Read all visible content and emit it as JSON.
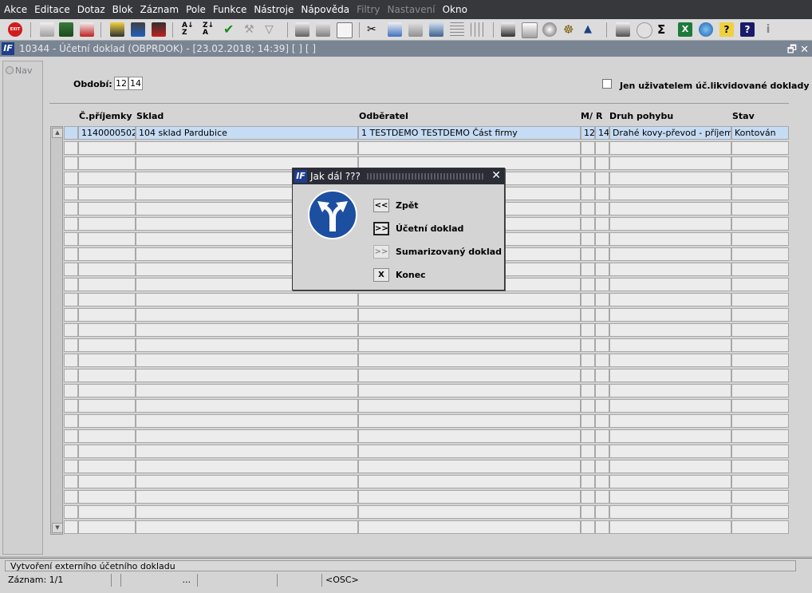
{
  "menu": [
    "Akce",
    "Editace",
    "Dotaz",
    "Blok",
    "Záznam",
    "Pole",
    "Funkce",
    "Nástroje",
    "Nápověda",
    "Filtry",
    "Nastavení",
    "Okno"
  ],
  "menu_disabled": [
    "Filtry",
    "Nastavení"
  ],
  "window": {
    "title": "10344 - Účetní doklad (OBPRDOK) - [23.02.2018; 14:39]  [ ]  [ ]",
    "nav_label": "Nav"
  },
  "form": {
    "period_label": "Období:",
    "period_month": "12",
    "period_year": "14",
    "only_user_label": "Jen uživatelem úč.likvidované doklady",
    "only_user_checked": false
  },
  "table": {
    "columns": [
      "Č.příjemky",
      "Sklad",
      "Odběratel",
      "M/",
      "R",
      "Druh pohybu",
      "Stav"
    ],
    "rows": [
      {
        "cislo": "1140000502",
        "sklad": "104 sklad Pardubice",
        "odberatel": "1 TESTDEMO TESTDEMO Část firmy",
        "m": "12",
        "r": "14",
        "druh": "Drahé kovy-převod - příjem",
        "stav": "Kontován"
      }
    ],
    "visible_row_count": 27
  },
  "dialog": {
    "title": "Jak dál ???",
    "icon": "split-arrow-icon",
    "options": [
      {
        "key": "<<",
        "label": "Zpět",
        "state": "normal"
      },
      {
        "key": ">>",
        "label": "Účetní doklad",
        "state": "active"
      },
      {
        "key": ">>",
        "label": "Sumarizovaný doklad",
        "state": "disabled"
      },
      {
        "key": "X",
        "label": "Konec",
        "state": "normal"
      }
    ]
  },
  "status": {
    "message": "Vytvoření externího účetního dokladu",
    "record": "Záznam: 1/1",
    "dots": "...",
    "mode": "<OSC>"
  },
  "colors": {
    "menubar": "#36383b",
    "window_title": "#7a8594",
    "dialog_title": "#2a2d36",
    "selected_row": "#c6dcf4",
    "icon_blue": "#1d4fa0"
  }
}
